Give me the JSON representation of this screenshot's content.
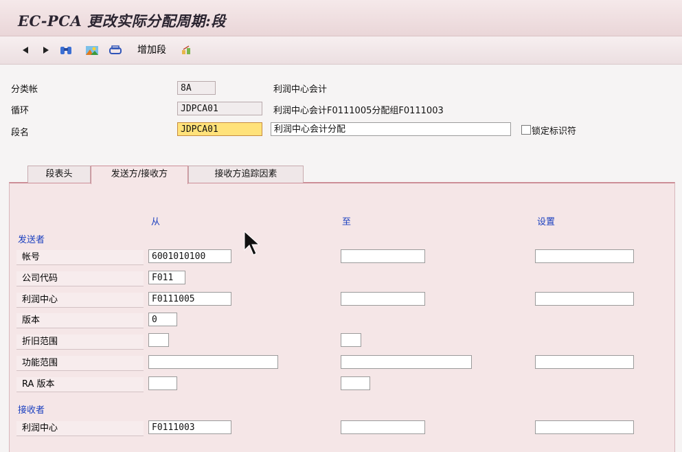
{
  "window": {
    "title": "EC-PCA 更改实际分配周期:段"
  },
  "toolbar": {
    "add_segment_label": "增加段"
  },
  "header": {
    "ledger": {
      "label": "分类帐",
      "value": "8A",
      "desc": "利润中心会计"
    },
    "cycle": {
      "label": "循环",
      "value": "JDPCA01",
      "desc": "利润中心会计F0111005分配组F0111003"
    },
    "segment": {
      "label": "段名",
      "value": "JDPCA01",
      "desc": "利润中心会计分配"
    },
    "lock": {
      "label": "锁定标识符",
      "checked": false
    }
  },
  "tabs": [
    {
      "label": "段表头"
    },
    {
      "label": "发送方/接收方"
    },
    {
      "label": "接收方追踪因素"
    }
  ],
  "columns": {
    "from": "从",
    "to": "至",
    "set": "设置"
  },
  "sender": {
    "section": "发送者",
    "account": {
      "label": "帐号",
      "from": "6001010100",
      "to": "",
      "set": ""
    },
    "company_code": {
      "label": "公司代码",
      "from": "F011"
    },
    "profit_center": {
      "label": "利润中心",
      "from": "F0111005",
      "to": "",
      "set": ""
    },
    "version": {
      "label": "版本",
      "from": "0"
    },
    "dep_area": {
      "label": "折旧范围",
      "from": "",
      "to": ""
    },
    "func_area": {
      "label": "功能范围",
      "from": "",
      "to": "",
      "set": ""
    },
    "ra_version": {
      "label": "RA 版本",
      "from": "",
      "to": ""
    }
  },
  "receiver": {
    "section": "接收者",
    "profit_center": {
      "label": "利润中心",
      "from": "F0111003",
      "to": "",
      "set": ""
    }
  },
  "colors": {
    "accent": "#cc8e97",
    "link_blue": "#1a3fbf",
    "highlight": "#ffe27a"
  }
}
